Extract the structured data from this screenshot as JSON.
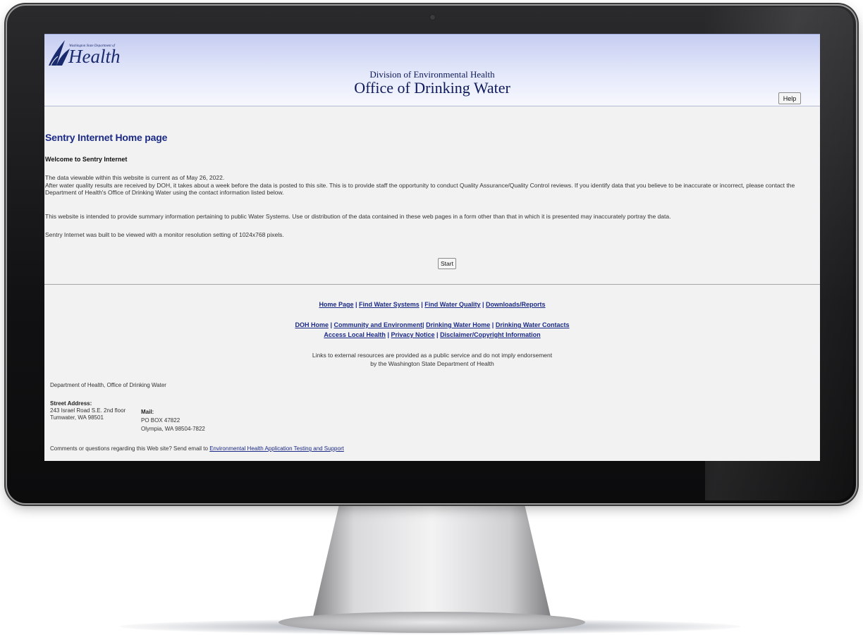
{
  "header": {
    "logo_small": "Washington State Department of",
    "logo_word": "Health",
    "division": "Division of Environmental Health",
    "office": "Office of Drinking Water",
    "help_label": "Help"
  },
  "main": {
    "title": "Sentry Internet Home page",
    "welcome": "Welcome to Sentry Internet",
    "para1_line1": "The data viewable within this website is current as of May 26, 2022.",
    "para1_line2": "After water quality results are received by DOH, it takes about a week before the data is posted to this site. This is to provide staff the opportunity to conduct Quality Assurance/Quality Control reviews. If you identify data that you believe to be inaccurate or incorrect, please contact the Department of Health's Office of Drinking Water using the contact information listed below.",
    "para2": "This website is intended to provide summary information pertaining to public Water Systems. Use or distribution of the data contained in these web pages in a form other than that in which it is presented may inaccurately portray the data.",
    "para3": "Sentry Internet was built to be viewed with a monitor resolution setting of 1024x768 pixels.",
    "start_label": "Start"
  },
  "footer": {
    "nav1": [
      "Home Page",
      "Find Water Systems",
      "Find Water Quality",
      "Downloads/Reports"
    ],
    "nav2": [
      "DOH Home",
      "Community and Environment",
      "Drinking Water Home",
      "Drinking Water Contacts"
    ],
    "nav3": [
      "Access Local Health",
      "Privacy Notice",
      "Disclaimer/Copyright Information"
    ],
    "external_line1": "Links to external resources are provided as a public service and do not imply endorsement",
    "external_line2": "by the Washington State Department of Health",
    "dept": "Department of Health, Office of Drinking Water",
    "street_label": "Street Address:",
    "street_line1": "243 Israel Road S.E. 2nd floor",
    "street_line2": "Tumwater, WA 98501",
    "mail_label": "Mail:",
    "mail_line1": "PO BOX 47822",
    "mail_line2": "Olympia, WA 98504-7822",
    "comments_prefix": "Comments or questions regarding this Web site?  Send email to ",
    "comments_link": "Environmental Health Application Testing and Support"
  },
  "colors": {
    "accent": "#1b2a86",
    "header_top": "#c5cdf1",
    "page_bg": "#f2f2f2"
  }
}
